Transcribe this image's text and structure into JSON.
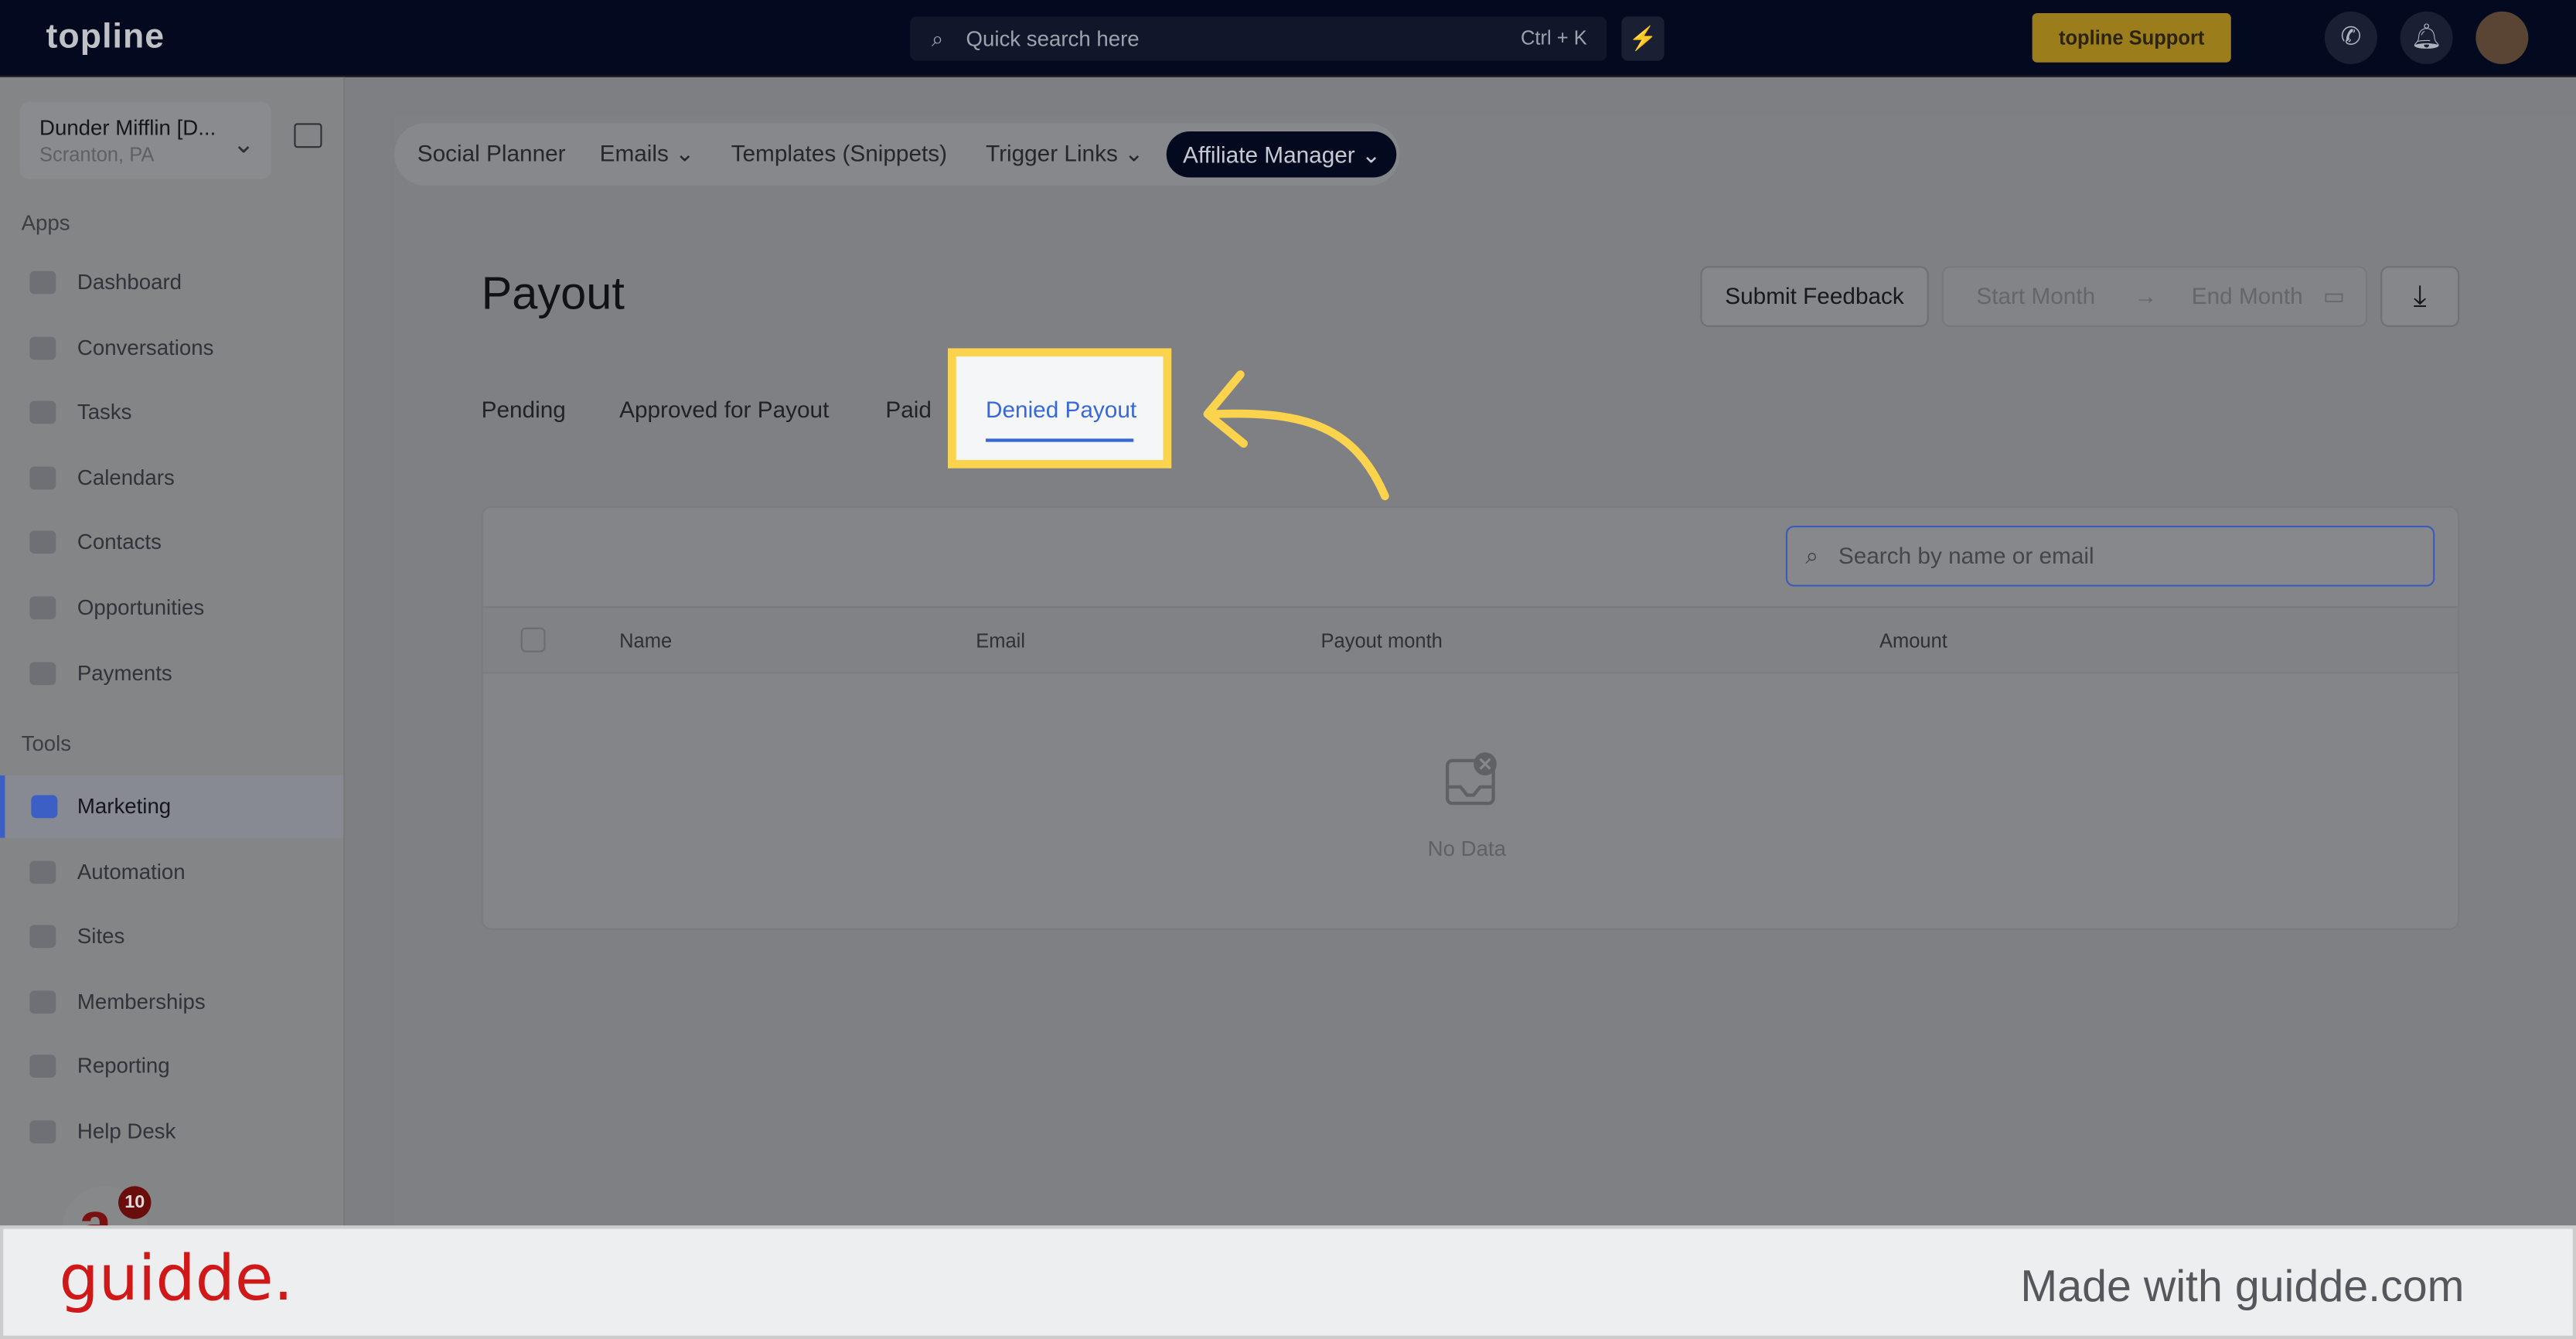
{
  "topbar": {
    "logo": "topline",
    "search_placeholder": "Quick search here",
    "shortcut": "Ctrl + K",
    "support": "topline Support",
    "icons": [
      "search-icon",
      "bolt-icon",
      "phone-icon",
      "bell-icon",
      "avatar"
    ]
  },
  "sidebar": {
    "account_name": "Dunder Mifflin [D...",
    "account_location": "Scranton, PA",
    "apps_label": "Apps",
    "tools_label": "Tools",
    "apps": [
      {
        "label": "Dashboard"
      },
      {
        "label": "Conversations"
      },
      {
        "label": "Tasks"
      },
      {
        "label": "Calendars"
      },
      {
        "label": "Contacts"
      },
      {
        "label": "Opportunities"
      },
      {
        "label": "Payments"
      }
    ],
    "tools": [
      {
        "label": "Marketing",
        "active": true
      },
      {
        "label": "Automation"
      },
      {
        "label": "Sites"
      },
      {
        "label": "Memberships"
      },
      {
        "label": "Reporting"
      },
      {
        "label": "Help Desk"
      }
    ],
    "notification_count": "10"
  },
  "nav": {
    "items": [
      "Social Planner",
      "Emails",
      "Templates (Snippets)",
      "Trigger Links",
      "Affiliate Manager"
    ],
    "active": "Affiliate Manager"
  },
  "page": {
    "title": "Payout",
    "submit_feedback": "Submit Feedback",
    "start_month": "Start Month",
    "end_month": "End Month",
    "tabs": [
      "Pending",
      "Approved for Payout",
      "Paid",
      "Denied Payout"
    ],
    "active_tab": "Denied Payout",
    "search_placeholder": "Search by name or email",
    "columns": [
      "Name",
      "Email",
      "Payout month",
      "Amount"
    ],
    "empty": "No Data"
  },
  "colors": {
    "accent": "#3768d8",
    "highlight": "#fcd34d",
    "arrow": "#fcd34d",
    "brand": "#d01818"
  },
  "footer": {
    "logo": "guidde.",
    "made_with": "Made with guidde.com"
  }
}
